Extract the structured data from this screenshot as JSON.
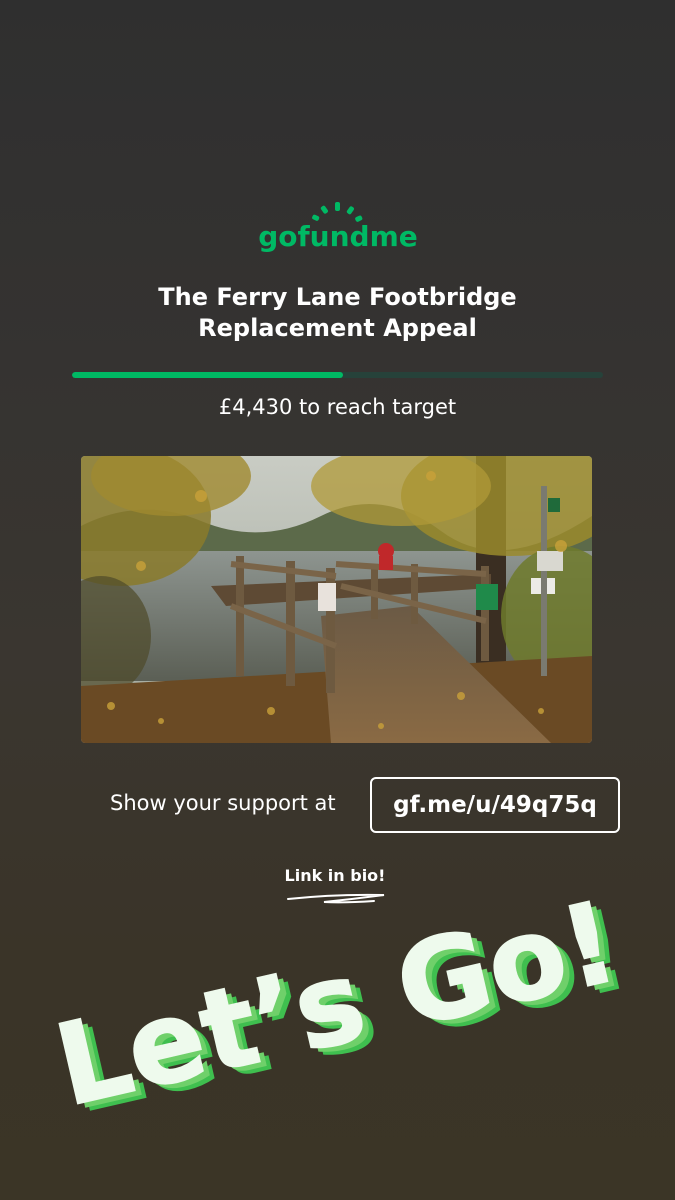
{
  "brand": {
    "logo_text": "gofundme",
    "color": "#00b964"
  },
  "campaign": {
    "title_line1": "The Ferry Lane Footbridge",
    "title_line2": "Replacement Appeal",
    "progress_fraction": 0.51,
    "remaining_text": "£4,430 to reach target"
  },
  "photo": {
    "icon": "footbridge-photo"
  },
  "support": {
    "label": "Show your support at",
    "link": "gf.me/u/49q75q"
  },
  "bio_text": "Link in bio!",
  "sticker": {
    "text": "Let’s Go!",
    "fill_color": "#eefaed",
    "shadow_color": "#3fbf4f"
  }
}
